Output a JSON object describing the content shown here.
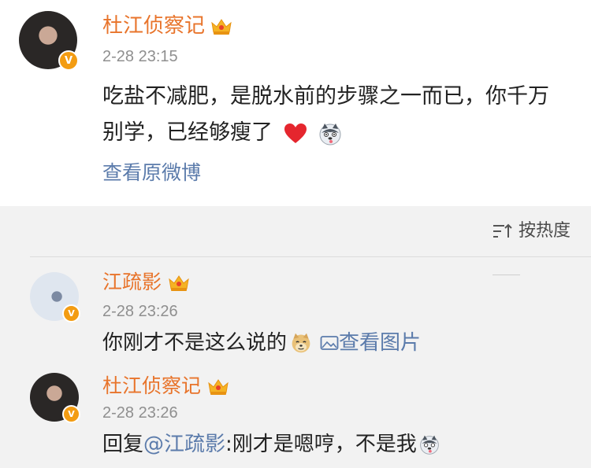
{
  "post": {
    "author": "杜江侦察记",
    "time": "2-28 23:15",
    "text": "吃盐不减肥，是脱水前的步骤之一而已，你千万别学，已经够瘦了",
    "view_original": "查看原微博",
    "verified_badge": "V"
  },
  "sort": {
    "label": "按热度",
    "icon": "sort-icon"
  },
  "comments": [
    {
      "author": "江疏影",
      "time": "2-28 23:26",
      "text": "你刚才不是这么说的",
      "view_pic": "查看图片",
      "verified_badge": "V"
    },
    {
      "author": "杜江侦察记",
      "time": "2-28 23:26",
      "reply_prefix": "回复",
      "mention": "@江疏影",
      "reply_text": ":刚才是嗯哼，不是我",
      "verified_badge": "V"
    }
  ],
  "colors": {
    "username": "#e8742b",
    "link": "#5b7bab",
    "time": "#8f8f8f",
    "badge": "#f39c12"
  }
}
